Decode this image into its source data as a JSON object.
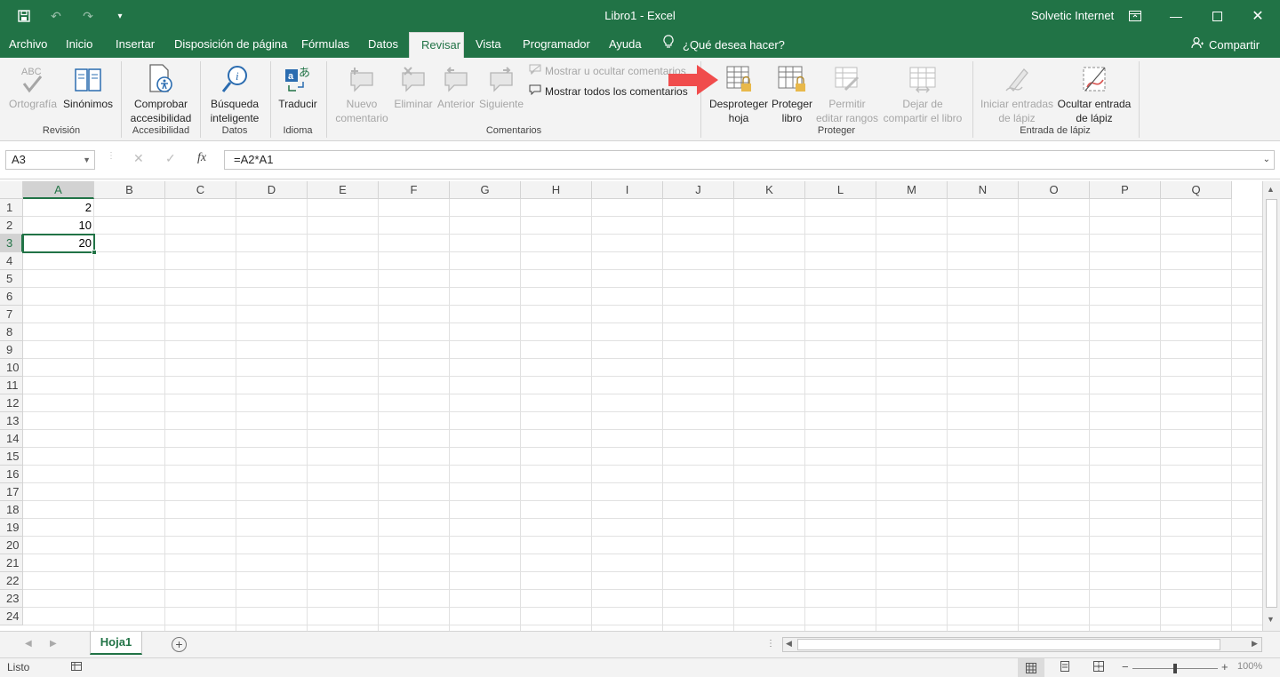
{
  "app": {
    "title": "Libro1 - Excel",
    "user": "Solvetic Internet",
    "colors": {
      "brand": "#217346",
      "arrow": "#f04c4c"
    }
  },
  "qat": {
    "save_icon": "save-icon",
    "undo_icon": "undo-icon",
    "redo_icon": "redo-icon",
    "customize_icon": "customize-icon"
  },
  "tabs": [
    "Archivo",
    "Inicio",
    "Insertar",
    "Disposición de página",
    "Fórmulas",
    "Datos",
    "Revisar",
    "Vista",
    "Programador",
    "Ayuda"
  ],
  "active_tab": "Revisar",
  "tell_me": "¿Qué desea hacer?",
  "share": "Compartir",
  "ribbon": {
    "revision": {
      "label": "Revisión",
      "spelling": "Ortografía",
      "synonyms": "Sinónimos"
    },
    "accesibilidad": {
      "label": "Accesibilidad",
      "check_l1": "Comprobar",
      "check_l2": "accesibilidad"
    },
    "datos": {
      "label": "Datos",
      "smart_l1": "Búsqueda",
      "smart_l2": "inteligente"
    },
    "idioma": {
      "label": "Idioma",
      "translate": "Traducir"
    },
    "comentarios": {
      "label": "Comentarios",
      "new_l1": "Nuevo",
      "new_l2": "comentario",
      "delete": "Eliminar",
      "previous": "Anterior",
      "next": "Siguiente",
      "show_hide": "Mostrar u ocultar comentarios",
      "show_all": "Mostrar todos los comentarios"
    },
    "proteger": {
      "label": "Proteger",
      "unprotect_l1": "Desproteger",
      "unprotect_l2": "hoja",
      "protect_l1": "Proteger",
      "protect_l2": "libro",
      "allow_l1": "Permitir",
      "allow_l2": "editar rangos",
      "unshare_l1": "Dejar de",
      "unshare_l2": "compartir el libro"
    },
    "lapiz": {
      "label": "Entrada de lápiz",
      "start_l1": "Iniciar entradas",
      "start_l2": "de lápiz",
      "hide_l1": "Ocultar entrada",
      "hide_l2": "de lápiz"
    }
  },
  "formula_bar": {
    "name_box": "A3",
    "formula": "=A2*A1",
    "fx": "fx"
  },
  "grid": {
    "columns": [
      "A",
      "B",
      "C",
      "D",
      "E",
      "F",
      "G",
      "H",
      "I",
      "J",
      "K",
      "L",
      "M",
      "N",
      "O",
      "P",
      "Q"
    ],
    "rows": [
      "1",
      "2",
      "3",
      "4",
      "5",
      "6",
      "7",
      "8",
      "9",
      "10",
      "11",
      "12",
      "13",
      "14",
      "15",
      "16",
      "17",
      "18",
      "19",
      "20",
      "21",
      "22",
      "23",
      "24"
    ],
    "selected_cell": "A3",
    "cells": {
      "A1": "2",
      "A2": "10",
      "A3": "20"
    }
  },
  "sheets": {
    "active": "Hoja1"
  },
  "status": {
    "ready": "Listo",
    "zoom": "100%"
  }
}
